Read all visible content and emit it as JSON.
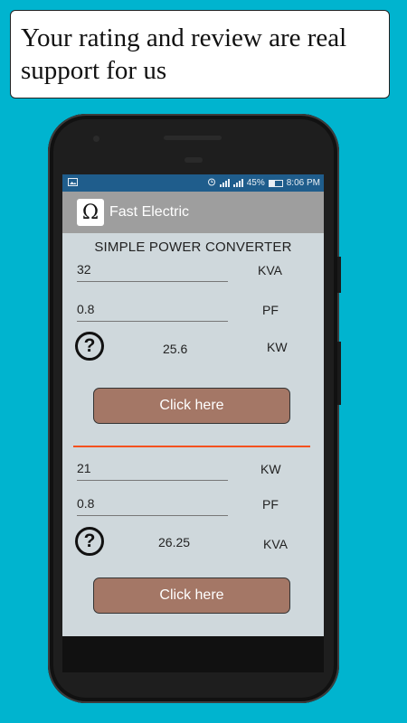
{
  "banner": {
    "text": "Your rating and review are real support for us"
  },
  "status_bar": {
    "battery": "45%",
    "time": "8:06 PM"
  },
  "app_bar": {
    "logo": "Ω",
    "title": "Fast Electric"
  },
  "screen_title": "SIMPLE POWER CONVERTER",
  "converter_1": {
    "input_value": "32",
    "input_unit": "KVA",
    "pf_value": "0.8",
    "pf_unit": "PF",
    "help_symbol": "?",
    "result_value": "25.6",
    "result_unit": "KW",
    "button_label": "Click here"
  },
  "converter_2": {
    "input_value": "21",
    "input_unit": "KW",
    "pf_value": "0.8",
    "pf_unit": "PF",
    "help_symbol": "?",
    "result_value": "26.25",
    "result_unit": "KVA",
    "button_label": "Click here"
  },
  "colors": {
    "background": "#00b4cf",
    "status_bar": "#1f5d8c",
    "app_bar": "#9e9e9e",
    "screen": "#cfd8dc",
    "button": "#a47766",
    "divider": "#f4511e"
  }
}
